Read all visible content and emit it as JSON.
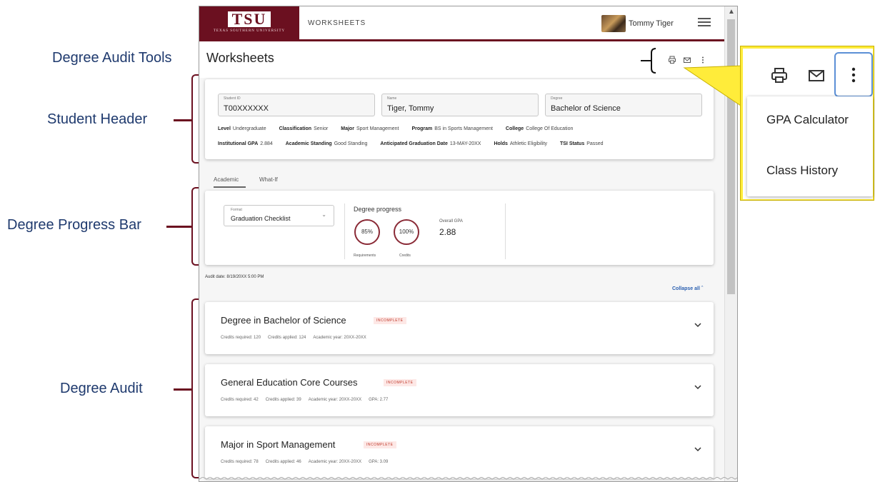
{
  "annotations": {
    "tools": "Degree Audit Tools",
    "header": "Student Header",
    "progress": "Degree Progress Bar",
    "audit": "Degree Audit"
  },
  "topbar": {
    "logo_text": "TSU",
    "logo_subtext": "TEXAS SOUTHERN UNIVERSITY",
    "nav_title": "WORKSHEETS",
    "user_name": "Tommy Tiger",
    "brand_color": "#6b1020"
  },
  "page": {
    "title": "Worksheets"
  },
  "student": {
    "id_label": "Student ID",
    "id_value": "T00XXXXXX",
    "name_label": "Name",
    "name_value": "Tiger, Tommy",
    "degree_label": "Degree",
    "degree_value": "Bachelor of Science",
    "row1": [
      {
        "label": "Level",
        "value": "Undergraduate"
      },
      {
        "label": "Classification",
        "value": "Senior"
      },
      {
        "label": "Major",
        "value": "Sport Management"
      },
      {
        "label": "Program",
        "value": "BS in Sports Management"
      },
      {
        "label": "College",
        "value": "College Of Education"
      }
    ],
    "row2": [
      {
        "label": "Institutional GPA",
        "value": "2.884"
      },
      {
        "label": "Academic Standing",
        "value": "Good Standing"
      },
      {
        "label": "Anticipated Graduation Date",
        "value": "13-MAY-20XX"
      },
      {
        "label": "Holds",
        "value": "Athletic Eligibility"
      },
      {
        "label": "TSI Status",
        "value": "Passed"
      }
    ]
  },
  "tabs": [
    "Academic",
    "What-If"
  ],
  "progress": {
    "format_label": "Format",
    "format_value": "Graduation Checklist",
    "title": "Degree progress",
    "requirements_pct": "85%",
    "requirements_label": "Requirements",
    "credits_pct": "100%",
    "credits_label": "Credits",
    "gpa_label": "Overall GPA",
    "gpa_value": "2.88"
  },
  "audit_date": "Audit date: 8/19/20XX   5:00 PM",
  "collapse_all": "Collapse all",
  "audits": [
    {
      "title": "Degree in Bachelor of Science",
      "status": "INCOMPLETE",
      "meta": [
        "Credits required: 120",
        "Credits applied: 124",
        "Academic year: 20XX-20XX"
      ]
    },
    {
      "title": "General Education Core Courses",
      "status": "INCOMPLETE",
      "meta": [
        "Credits required: 42",
        "Credits applied: 39",
        "Academic year: 20XX-20XX",
        "GPA: 2.77"
      ]
    },
    {
      "title": "Major in Sport Management",
      "status": "INCOMPLETE",
      "meta": [
        "Credits required: 78",
        "Credits applied: 46",
        "Academic year: 20XX-20XX",
        "GPA: 3.09"
      ]
    }
  ],
  "popout": {
    "items": [
      "GPA Calculator",
      "Class History"
    ],
    "highlight_color": "#ffec3a"
  }
}
